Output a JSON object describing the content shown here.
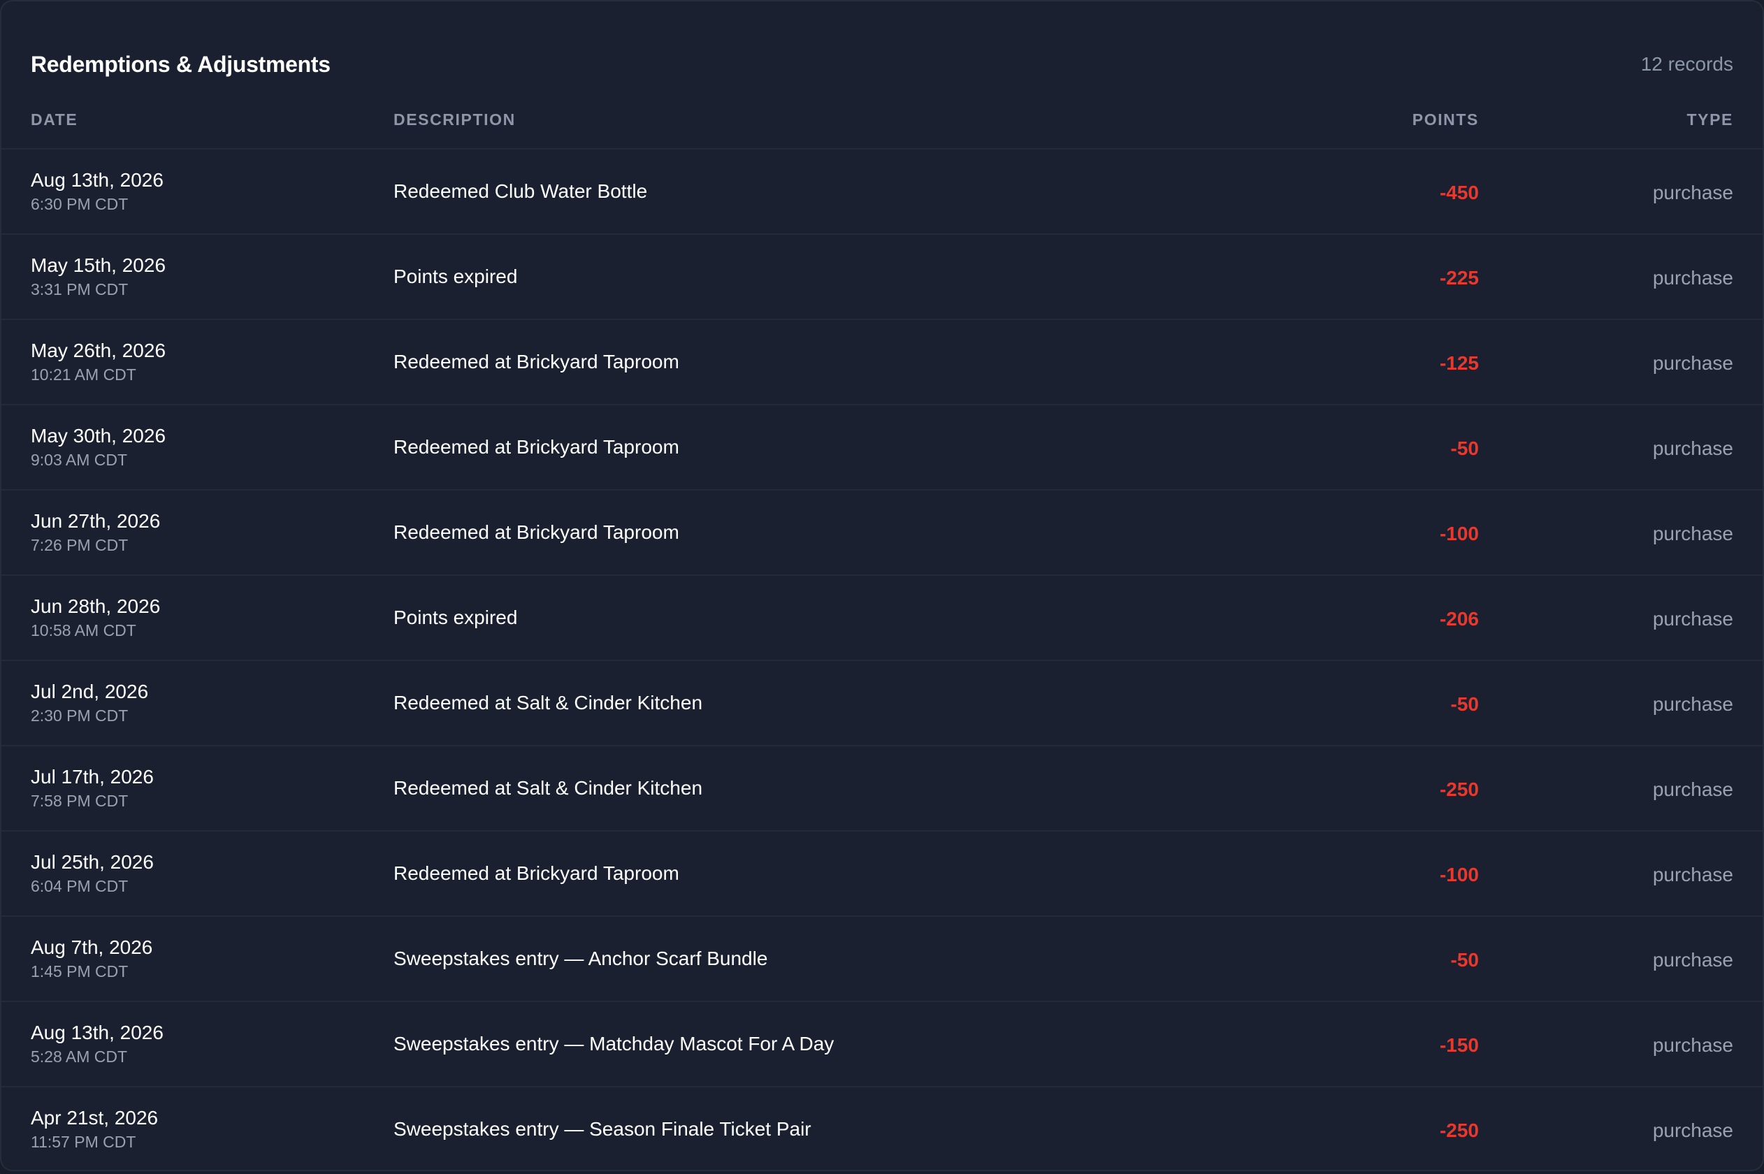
{
  "header": {
    "title": "Redemptions & Adjustments",
    "record_count": "12 records"
  },
  "columns": {
    "date": "DATE",
    "description": "DESCRIPTION",
    "points": "POINTS",
    "type": "TYPE"
  },
  "colors": {
    "background": "#1a2030",
    "negative_points": "#e8392f",
    "muted_text": "#8e97a8"
  },
  "rows": [
    {
      "date": "Aug 13th, 2026",
      "time": "6:30 PM CDT",
      "description": "Redeemed Club Water Bottle",
      "points": "-450",
      "type": "purchase"
    },
    {
      "date": "May 15th, 2026",
      "time": "3:31 PM CDT",
      "description": "Points expired",
      "points": "-225",
      "type": "purchase"
    },
    {
      "date": "May 26th, 2026",
      "time": "10:21 AM CDT",
      "description": "Redeemed at Brickyard Taproom",
      "points": "-125",
      "type": "purchase"
    },
    {
      "date": "May 30th, 2026",
      "time": "9:03 AM CDT",
      "description": "Redeemed at Brickyard Taproom",
      "points": "-50",
      "type": "purchase"
    },
    {
      "date": "Jun 27th, 2026",
      "time": "7:26 PM CDT",
      "description": "Redeemed at Brickyard Taproom",
      "points": "-100",
      "type": "purchase"
    },
    {
      "date": "Jun 28th, 2026",
      "time": "10:58 AM CDT",
      "description": "Points expired",
      "points": "-206",
      "type": "purchase"
    },
    {
      "date": "Jul 2nd, 2026",
      "time": "2:30 PM CDT",
      "description": "Redeemed at Salt & Cinder Kitchen",
      "points": "-50",
      "type": "purchase"
    },
    {
      "date": "Jul 17th, 2026",
      "time": "7:58 PM CDT",
      "description": "Redeemed at Salt & Cinder Kitchen",
      "points": "-250",
      "type": "purchase"
    },
    {
      "date": "Jul 25th, 2026",
      "time": "6:04 PM CDT",
      "description": "Redeemed at Brickyard Taproom",
      "points": "-100",
      "type": "purchase"
    },
    {
      "date": "Aug 7th, 2026",
      "time": "1:45 PM CDT",
      "description": "Sweepstakes entry — Anchor Scarf Bundle",
      "points": "-50",
      "type": "purchase"
    },
    {
      "date": "Aug 13th, 2026",
      "time": "5:28 AM CDT",
      "description": "Sweepstakes entry — Matchday Mascot For A Day",
      "points": "-150",
      "type": "purchase"
    },
    {
      "date": "Apr 21st, 2026",
      "time": "11:57 PM CDT",
      "description": "Sweepstakes entry — Season Finale Ticket Pair",
      "points": "-250",
      "type": "purchase"
    }
  ]
}
